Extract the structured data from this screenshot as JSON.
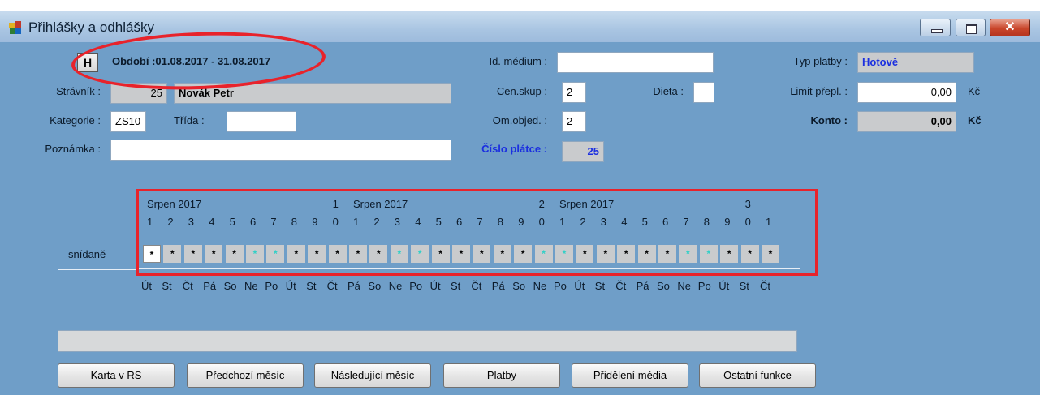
{
  "window": {
    "title": "Přihlášky a odhlášky"
  },
  "header": {
    "period_button": "H",
    "period": "Období :01.08.2017 - 31.08.2017"
  },
  "form": {
    "stravnik_label": "Strávník :",
    "stravnik_id": "25",
    "stravnik_name": "Novák Petr",
    "kategorie_label": "Kategorie :",
    "kategorie_value": "ZS10",
    "trida_label": "Třída :",
    "trida_value": "",
    "poznamka_label": "Poznámka :",
    "poznamka_value": "",
    "id_medium_label": "Id. médium :",
    "id_medium_value": "",
    "censkup_label": "Cen.skup :",
    "censkup_value": "2",
    "dieta_label": "Dieta :",
    "dieta_value": "",
    "omobjed_label": "Om.objed. :",
    "omobjed_value": "2",
    "cislo_platce_label": "Číslo plátce :",
    "cislo_platce_value": "25",
    "typ_platby_label": "Typ platby :",
    "typ_platby_value": "Hotově",
    "limit_label": "Limit přepl. :",
    "limit_value": "0,00",
    "limit_currency": "Kč",
    "konto_label": "Konto :",
    "konto_value": "0,00",
    "konto_currency": "Kč"
  },
  "calendar": {
    "month_labels": [
      "Srpen 2017",
      "Srpen 2017",
      "Srpen 2017"
    ],
    "tens_digits": [
      "1",
      "2",
      "3"
    ],
    "day_digits": [
      "1",
      "2",
      "3",
      "4",
      "5",
      "6",
      "7",
      "8",
      "9",
      "0",
      "1",
      "2",
      "3",
      "4",
      "5",
      "6",
      "7",
      "8",
      "9",
      "0",
      "1",
      "2",
      "3",
      "4",
      "5",
      "6",
      "7",
      "8",
      "9",
      "0",
      "1"
    ],
    "weekdays": [
      "Út",
      "St",
      "Čt",
      "Pá",
      "So",
      "Ne",
      "Po",
      "Út",
      "St",
      "Čt",
      "Pá",
      "So",
      "Ne",
      "Po",
      "Út",
      "St",
      "Čt",
      "Pá",
      "So",
      "Ne",
      "Po",
      "Út",
      "St",
      "Čt",
      "Pá",
      "So",
      "Ne",
      "Po",
      "Út",
      "St",
      "Čt"
    ],
    "meal_label": "snídaně",
    "meal_cells": [
      "*",
      "*",
      "*",
      "*",
      "*",
      "*",
      "*",
      "*",
      "*",
      "*",
      "*",
      "*",
      "*",
      "*",
      "*",
      "*",
      "*",
      "*",
      "*",
      "*",
      "*",
      "*",
      "*",
      "*",
      "*",
      "*",
      "*",
      "*",
      "*",
      "*",
      "*"
    ],
    "weekend_days": [
      5,
      6,
      12,
      13,
      19,
      20,
      26,
      27
    ],
    "cell_color": "#c9cbcd",
    "weekend_star_color": "#2fd0c7"
  },
  "buttons": {
    "karta": "Karta v RS",
    "predchozi": "Předchozí měsíc",
    "nasledujici": "Následující měsíc",
    "platby": "Platby",
    "prideleni": "Přidělení média",
    "ostatni": "Ostatní funkce"
  },
  "colors": {
    "background": "#6f9ec8",
    "highlight": "#e8232b",
    "payment_type_text": "#1b2fe0"
  }
}
